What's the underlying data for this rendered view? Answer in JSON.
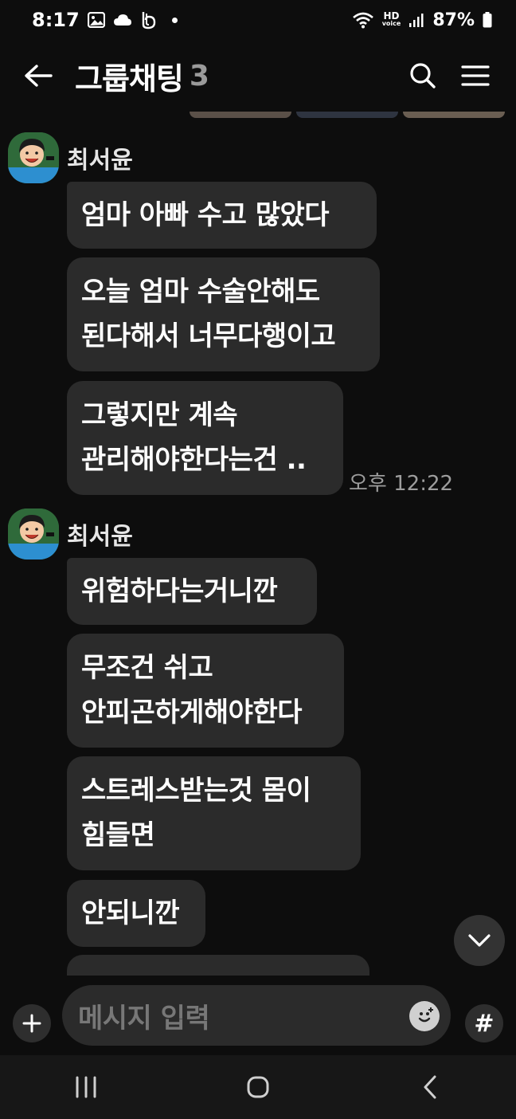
{
  "status_bar": {
    "time": "8:17",
    "hd_label_top": "HD",
    "hd_label_bottom": "voice",
    "battery": "87%"
  },
  "header": {
    "title": "그룹채팅",
    "member_count": "3",
    "icons": [
      "back-arrow-icon",
      "search-icon",
      "menu-icon"
    ]
  },
  "messages": {
    "group1": {
      "sender": "최서윤",
      "bubbles": [
        "엄마 아빠 수고 많았다",
        "오늘 엄마 수술안해도\n된다해서 너무다행이고",
        "그렇지만 계속\n관리해야한다는건 .."
      ],
      "timestamp": "오후 12:22"
    },
    "group2": {
      "sender": "최서윤",
      "bubbles": [
        "위험하다는거니깐",
        "무조건 쉬고\n안피곤하게해야한다",
        "스트레스받는것 몸이\n힘들면",
        "안되니깐"
      ]
    }
  },
  "composer": {
    "placeholder": "메시지 입력",
    "hash_label": "#"
  },
  "colors": {
    "background": "#0d0d0d",
    "bubble": "#2b2b2b",
    "timestamp": "#9d9d9d"
  }
}
